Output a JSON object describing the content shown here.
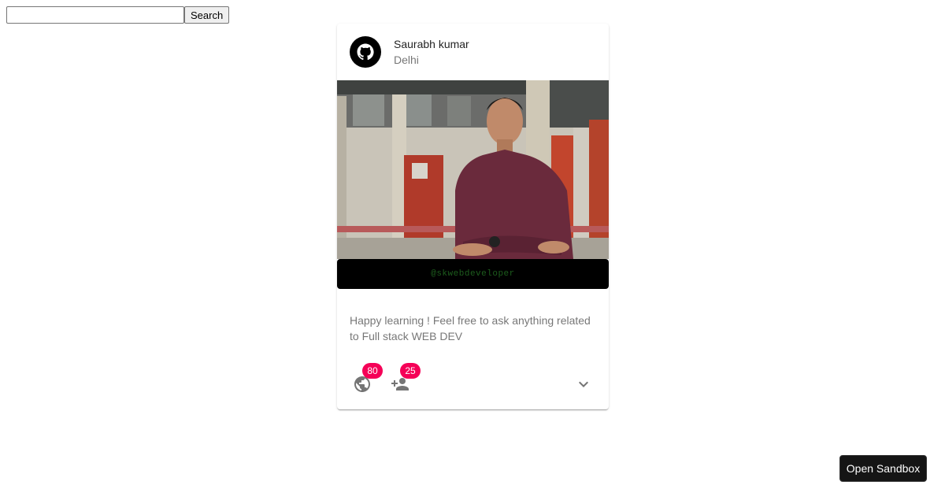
{
  "search": {
    "value": "",
    "placeholder": "",
    "button_label": "Search"
  },
  "card": {
    "title": "Saurabh kumar",
    "subheader": "Delhi",
    "watermark": "@skwebdeveloper",
    "body": "Happy learning ! Feel free to ask anything related to Full stack WEB DEV",
    "actions": {
      "globe_count": "80",
      "person_add_count": "25"
    }
  },
  "footer": {
    "open_sandbox_label": "Open Sandbox"
  },
  "colors": {
    "badge": "#f50057",
    "avatar_bg": "#000000",
    "sandbox_button": "#151515"
  }
}
